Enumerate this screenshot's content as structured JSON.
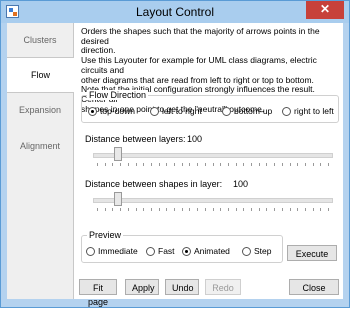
{
  "window": {
    "title": "Layout Control"
  },
  "tabs": [
    {
      "label": "Clusters"
    },
    {
      "label": "Flow",
      "active": true
    },
    {
      "label": "Expansion"
    },
    {
      "label": "Alignment"
    }
  ],
  "description": {
    "lines": [
      "Orders the shapes such that the majority of arrows points in the desired",
      "direction.",
      "Use this Layouter for example for UML class diagrams, electric circuits and",
      "other diagrams that are read from left to right or top to bottom.",
      "Note that the initial configuration strongly influences the result. Center all",
      "shapes in one point to get the \"neutral\" outcome."
    ]
  },
  "flow_direction": {
    "legend": "Flow Direction",
    "options": [
      {
        "label": "top-down",
        "selected": true
      },
      {
        "label": "left to right",
        "selected": false
      },
      {
        "label": "bottom-up",
        "selected": false
      },
      {
        "label": "right to left",
        "selected": false
      }
    ]
  },
  "layer_distance": {
    "label": "Distance between layers:",
    "value": "100",
    "slider_fraction": 0.09
  },
  "shape_distance": {
    "label": "Distance between shapes in layer:",
    "value": "100",
    "slider_fraction": 0.09
  },
  "preview": {
    "legend": "Preview",
    "options": [
      {
        "label": "Immediate",
        "selected": false
      },
      {
        "label": "Fast",
        "selected": false
      },
      {
        "label": "Animated",
        "selected": true
      },
      {
        "label": "Step",
        "selected": false
      }
    ]
  },
  "buttons": {
    "execute": "Execute",
    "fit_page": "Fit page",
    "apply": "Apply",
    "undo": "Undo",
    "redo": "Redo",
    "close": "Close"
  },
  "colors": {
    "titlebar": "#a9cdee",
    "close_button": "#c7413a",
    "window_border": "#5a9bd5"
  }
}
